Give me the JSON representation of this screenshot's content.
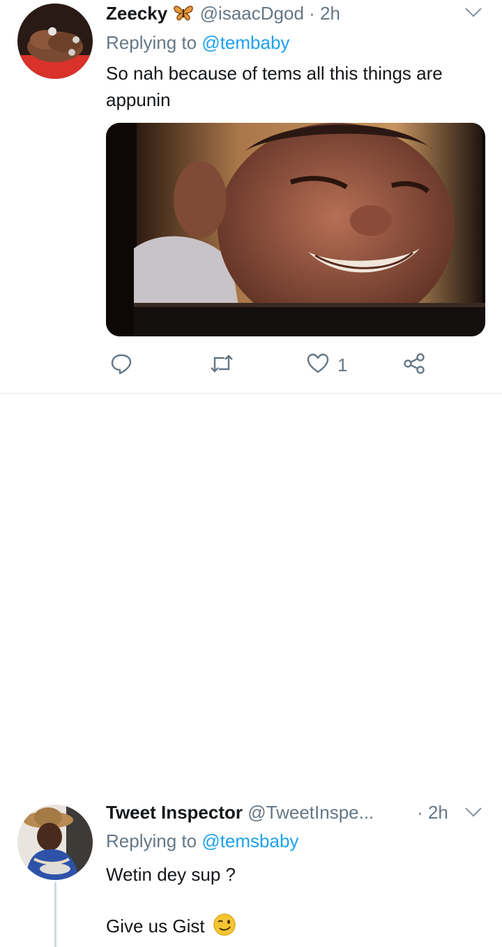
{
  "tweets": [
    {
      "display_name": "Zeecky",
      "handle": "@isaacDgod",
      "time": "2h",
      "replying_prefix": "Replying to",
      "replying_to": "@tembaby",
      "text": "So nah because of tems all this things are appunin",
      "actions": {
        "reply_count": "",
        "retweet_count": "",
        "like_count": "1"
      }
    },
    {
      "display_name": "Tweet Inspector",
      "handle": "@TweetInspe...",
      "time": "2h",
      "replying_prefix": "Replying to",
      "replying_to": "@temsbaby",
      "text_line1": "Wetin dey sup ?",
      "text_line2": "Give us Gist"
    }
  ],
  "icons": {
    "name_emoji": "butterfly-icon",
    "wink": "wink-emoji-icon",
    "reply": "reply-icon",
    "retweet": "retweet-icon",
    "like": "heart-icon",
    "share": "share-icon",
    "more": "chevron-down-icon"
  },
  "colors": {
    "link": "#1da1f2",
    "muted": "#657786",
    "text": "#14171a"
  }
}
